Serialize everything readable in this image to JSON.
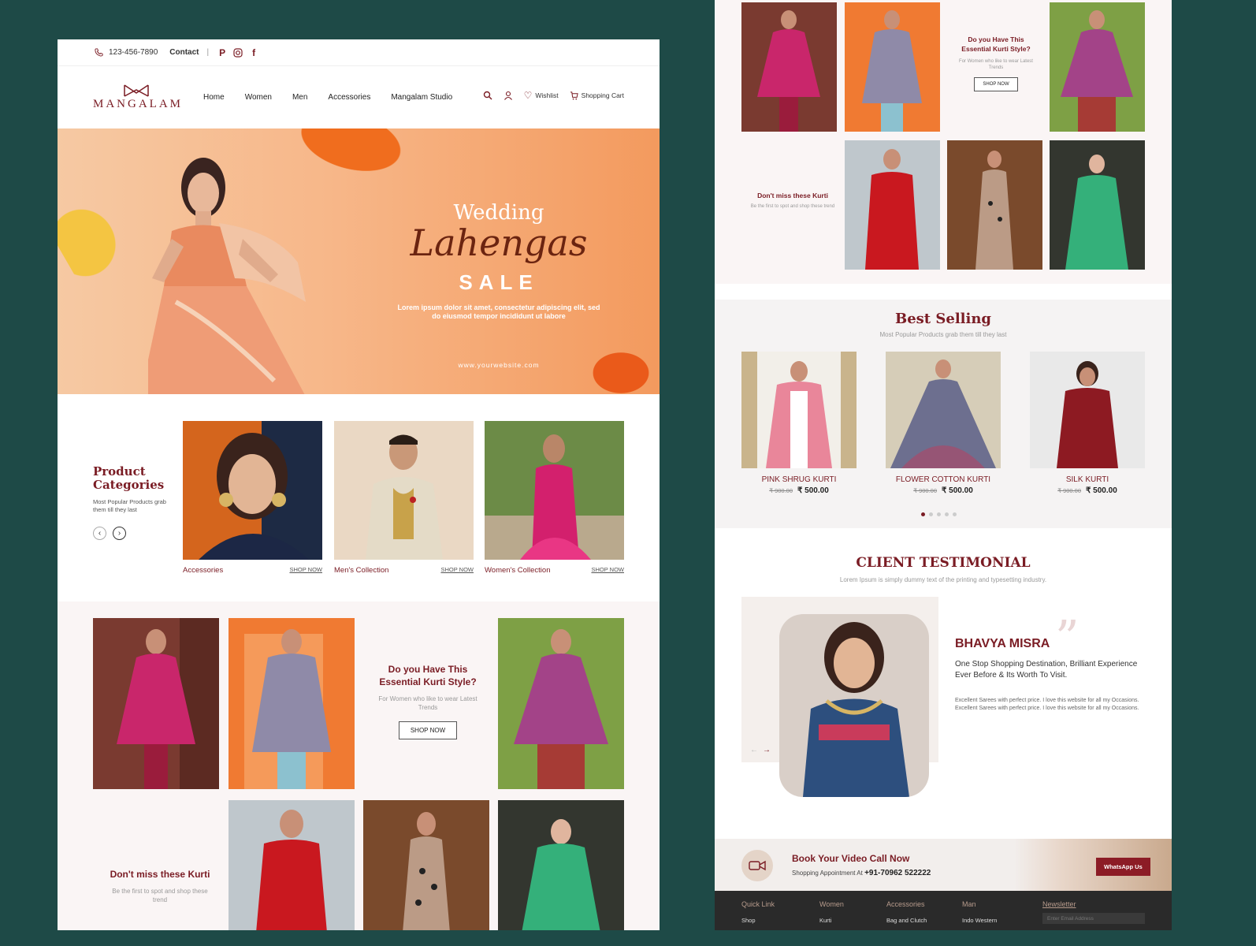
{
  "left": {
    "topbar": {
      "phone": "123-456-7890",
      "contact": "Contact"
    },
    "nav": {
      "brand": "MANGALAM",
      "menu": [
        "Home",
        "Women",
        "Men",
        "Accessories",
        "Mangalam Studio"
      ],
      "wishlist": "Wishlist",
      "cart": "Shopping Cart"
    },
    "hero": {
      "line1": "Wedding",
      "line2": "Lahengas",
      "line3": "SALE",
      "desc": "Lorem ipsum dolor sit amet, consectetur adipiscing elit, sed do eiusmod tempor incididunt ut labore",
      "url": "www.yourwebsite.com"
    },
    "categories": {
      "title": "Product Categories",
      "subtitle": "Most Popular Products grab them till they last",
      "items": [
        {
          "label": "Accessories",
          "shop": "SHOP NOW"
        },
        {
          "label": "Men's Collection",
          "shop": "SHOP NOW"
        },
        {
          "label": "Women's Collection",
          "shop": "SHOP NOW"
        }
      ]
    },
    "promo1": {
      "title": "Do you Have This Essential Kurti Style?",
      "sub": "For Women who like to wear Latest Trends",
      "button": "SHOP NOW"
    },
    "promo2": {
      "title": "Don't miss these Kurti",
      "sub": "Be the first to spot and shop these trend"
    }
  },
  "right": {
    "promo1": {
      "title": "Do you Have This Essential Kurti Style?",
      "sub": "For Women who like to wear Latest Trends",
      "button": "SHOP NOW"
    },
    "promo2": {
      "title": "Don't miss these Kurti",
      "sub": "Be the first to spot and shop these trend"
    },
    "best": {
      "title": "Best Selling",
      "subtitle": "Most Popular Products grab them till they last",
      "products": [
        {
          "name": "PINK SHRUG KURTI",
          "old": "₹ 900.00",
          "price": "₹ 500.00"
        },
        {
          "name": "FLOWER COTTON KURTI",
          "old": "₹ 900.00",
          "price": "₹ 500.00"
        },
        {
          "name": "SILK KURTI",
          "old": "₹ 900.00",
          "price": "₹ 500.00"
        }
      ],
      "carousel_pages": 5,
      "carousel_active": 1
    },
    "testimonial": {
      "title": "CLIENT TESTIMONIAL",
      "subtitle": "Lorem Ipsum is simply dummy text of the printing and typesetting industry.",
      "name": "BHAVYA MISRA",
      "headline": "One Stop Shopping Destination, Brilliant Experience Ever Before & Its Worth To Visit.",
      "body": "Excellent Sarees with perfect price. I love this website for all my Occasions. Excellent Sarees with perfect price. I love this website for all my Occasions."
    },
    "videocall": {
      "title": "Book Your Video Call Now",
      "prefix": "Shopping Appointment At",
      "phone": "+91-70962 522222",
      "whatsapp": "WhatsApp Us"
    },
    "footer": {
      "columns": [
        {
          "heading": "Quick Link",
          "item": "Shop"
        },
        {
          "heading": "Women",
          "item": "Kurti"
        },
        {
          "heading": "Accessories",
          "item": "Bag and Clutch"
        },
        {
          "heading": "Man",
          "item": "Indo Western"
        }
      ],
      "newsletter": {
        "heading": "Newsletter",
        "placeholder": "Enter Email Address"
      }
    }
  },
  "colors": {
    "brand": "#7a1c24",
    "background": "#1e4a47",
    "hero_orange": "#f39a5e"
  }
}
